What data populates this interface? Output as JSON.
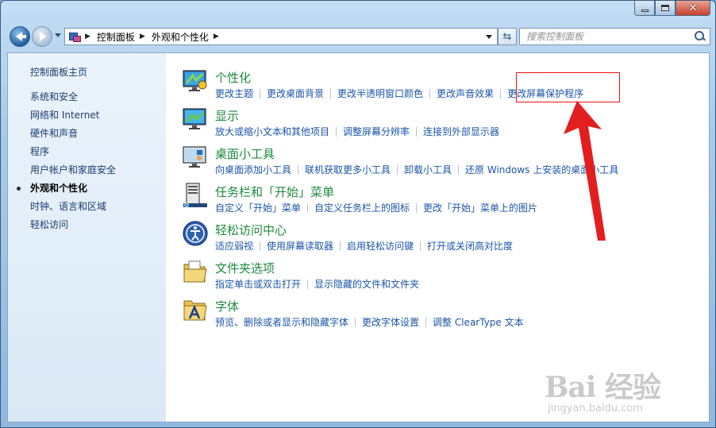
{
  "window": {
    "caption_buttons": [
      "minimize-icon",
      "maximize-icon",
      "close-icon"
    ]
  },
  "nav": {
    "back_icon": "back-arrow-icon",
    "forward_icon": "forward-arrow-icon",
    "breadcrumb": [
      "控制面板",
      "外观和个性化"
    ],
    "search_placeholder": "搜索控制面板"
  },
  "sidebar": {
    "home": "控制面板主页",
    "items": [
      {
        "label": "系统和安全",
        "active": false
      },
      {
        "label": "网络和 Internet",
        "active": false
      },
      {
        "label": "硬件和声音",
        "active": false
      },
      {
        "label": "程序",
        "active": false
      },
      {
        "label": "用户帐户和家庭安全",
        "active": false
      },
      {
        "label": "外观和个性化",
        "active": true
      },
      {
        "label": "时钟、语言和区域",
        "active": false
      },
      {
        "label": "轻松访问",
        "active": false
      }
    ]
  },
  "categories": [
    {
      "title": "个性化",
      "icon": "personalization-icon",
      "links": [
        "更改主题",
        "更改桌面背景",
        "更改半透明窗口颜色",
        "更改声音效果",
        "更改屏幕保护程序"
      ]
    },
    {
      "title": "显示",
      "icon": "display-icon",
      "links": [
        "放大或缩小文本和其他项目",
        "调整屏幕分辨率",
        "连接到外部显示器"
      ]
    },
    {
      "title": "桌面小工具",
      "icon": "gadgets-icon",
      "links": [
        "向桌面添加小工具",
        "联机获取更多小工具",
        "卸载小工具",
        "还原 Windows 上安装的桌面小工具"
      ]
    },
    {
      "title": "任务栏和「开始」菜单",
      "icon": "taskbar-icon",
      "links": [
        "自定义「开始」菜单",
        "自定义任务栏上的图标",
        "更改「开始」菜单上的图片"
      ]
    },
    {
      "title": "轻松访问中心",
      "icon": "ease-of-access-icon",
      "links": [
        "适应弱视",
        "使用屏幕读取器",
        "启用轻松访问键",
        "打开或关闭高对比度"
      ]
    },
    {
      "title": "文件夹选项",
      "icon": "folder-options-icon",
      "links": [
        "指定单击或双击打开",
        "显示隐藏的文件和文件夹"
      ]
    },
    {
      "title": "字体",
      "icon": "fonts-icon",
      "links": [
        "预览、删除或者显示和隐藏字体",
        "更改字体设置",
        "调整 ClearType 文本"
      ]
    }
  ],
  "annotation": {
    "highlight_color": "#e11111",
    "arrow_icon": "red-arrow-icon"
  },
  "watermark": {
    "logo": "Bai 经验",
    "url": "jingyan.baidu.com"
  }
}
